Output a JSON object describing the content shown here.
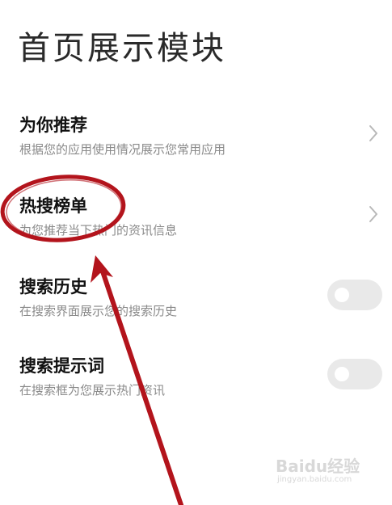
{
  "page": {
    "title": "首页展示模块"
  },
  "settings": [
    {
      "title": "为你推荐",
      "subtitle": "根据您的应用使用情况展示您常用应用",
      "control": "chevron"
    },
    {
      "title": "热搜榜单",
      "subtitle": "为您推荐当下热门的资讯信息",
      "control": "chevron"
    },
    {
      "title": "搜索历史",
      "subtitle": "在搜索界面展示您的搜索历史",
      "control": "toggle",
      "enabled": false
    },
    {
      "title": "搜索提示词",
      "subtitle": "在搜索框为您展示热门资讯",
      "control": "toggle",
      "enabled": false
    }
  ],
  "watermark": {
    "brand": "Baidu经验",
    "url": "jingyan.baidu.com"
  },
  "colors": {
    "annotation": "#b3141c",
    "toggle_off": "#e9e9e9",
    "subtitle": "#8a8a8a",
    "chevron": "#b8b8b8"
  },
  "icons": {
    "chevron": "chevron-right-icon",
    "annotation": "red-circle-arrow-annotation"
  }
}
